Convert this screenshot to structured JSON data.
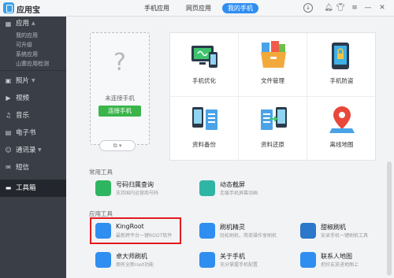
{
  "app": {
    "title": "应用宝"
  },
  "tabs": [
    {
      "label": "手机应用"
    },
    {
      "label": "网页应用"
    },
    {
      "label": "我的手机"
    }
  ],
  "sidebar": {
    "apps": {
      "label": "应用",
      "sub": [
        "我的应用",
        "可升级",
        "系统应用",
        "山寨应用检测"
      ]
    },
    "items": [
      {
        "label": "照片"
      },
      {
        "label": "视频"
      },
      {
        "label": "音乐"
      },
      {
        "label": "电子书"
      },
      {
        "label": "通讯录"
      },
      {
        "label": "短信"
      },
      {
        "label": "工具箱"
      }
    ]
  },
  "phone": {
    "no_connection": "未连接手机",
    "connect_button": "连接手机"
  },
  "features": [
    {
      "label": "手机优化",
      "icon": "phone-optimize-icon"
    },
    {
      "label": "文件管理",
      "icon": "file-manage-icon"
    },
    {
      "label": "手机防盗",
      "icon": "phone-antitheft-icon"
    },
    {
      "label": "资料备份",
      "icon": "backup-icon"
    },
    {
      "label": "资料还原",
      "icon": "restore-icon"
    },
    {
      "label": "离线地图",
      "icon": "offline-map-icon"
    }
  ],
  "common_tools": {
    "title": "常用工具",
    "items": [
      {
        "name": "号码归属查询",
        "desc": "支持国内运营商号码"
      },
      {
        "name": "动态截屏",
        "desc": "走缓手机屏幕动画"
      }
    ]
  },
  "app_tools": {
    "title": "应用工具",
    "items": [
      {
        "name": "KingRoot",
        "desc": "最新跨平台一键ROOT软件"
      },
      {
        "name": "刷机精灵",
        "desc": "轻松刷机，简单操作享刷机"
      },
      {
        "name": "甜椒刷机",
        "desc": "安卓手机一键刷机工具"
      },
      {
        "name": "卓大师刷机",
        "desc": "拥有全新root功能"
      },
      {
        "name": "关于手机",
        "desc": "充分掌握手机配置"
      },
      {
        "name": "联系人地图",
        "desc": "把好友放进地图上"
      }
    ]
  },
  "colors": {
    "accent": "#2f8ef0",
    "sidebar": "#3a3f47",
    "connect": "#3bb54a",
    "highlight": "#e5191e"
  }
}
